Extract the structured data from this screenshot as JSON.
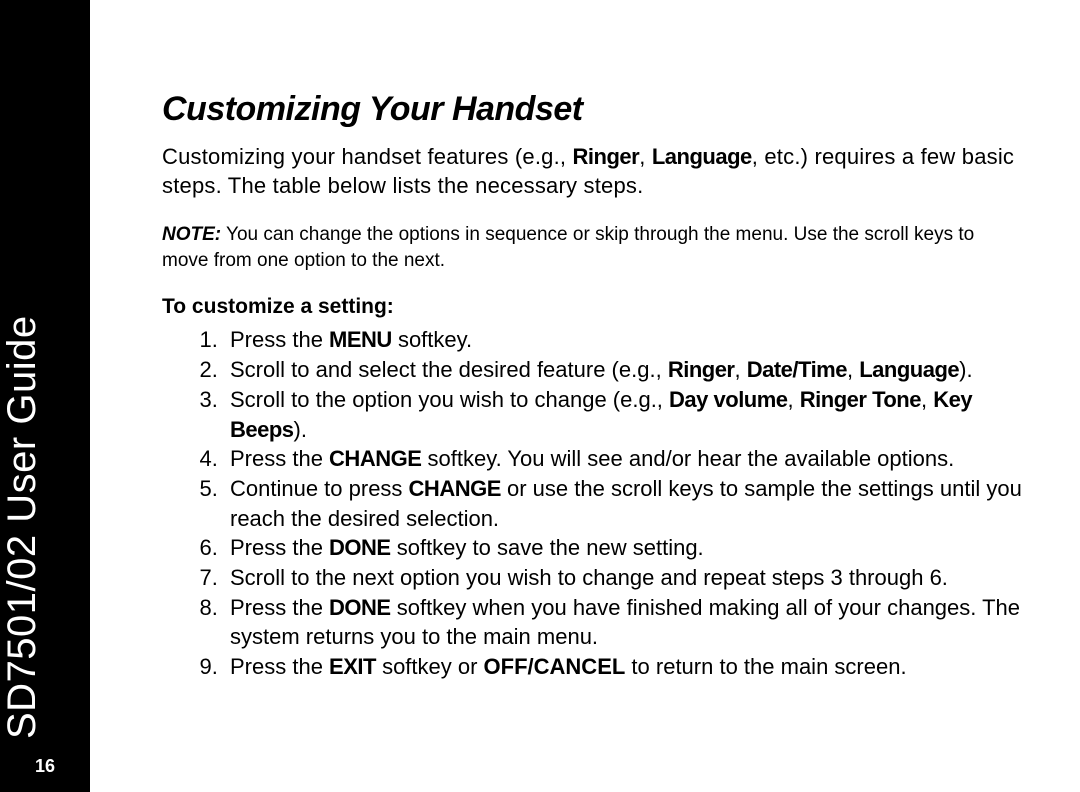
{
  "sidebar": {
    "guide_title": "SD7501/02 User Guide",
    "page_number": "16"
  },
  "content": {
    "heading": "Customizing Your Handset",
    "intro_pre": "Customizing your handset features (e.g., ",
    "intro_k1": "Ringer",
    "intro_mid1": ", ",
    "intro_k2": "Language",
    "intro_post": ", etc.) requires a few basic steps. The table below lists the necessary steps.",
    "note_label": "NOTE:",
    "note_body": "  You can change the options in sequence or skip through the menu. Use the scroll keys to move from one option to the next.",
    "subhead": "To customize a setting:",
    "steps": {
      "s1_pre": "Press the ",
      "s1_k": "MENU",
      "s1_post": " softkey.",
      "s2_pre": "Scroll to and select the desired feature (e.g., ",
      "s2_k1": "Ringer",
      "s2_c1": ", ",
      "s2_k2": "Date/Time",
      "s2_c2": ", ",
      "s2_k3": "Language",
      "s2_post": ").",
      "s3_pre": "Scroll to the option you wish to change (e.g., ",
      "s3_k1": "Day volume",
      "s3_c1": ", ",
      "s3_k2": "Ringer Tone",
      "s3_c2": ", ",
      "s3_k3": "Key Beeps",
      "s3_post": ").",
      "s4_pre": "Press the ",
      "s4_k": "CHANGE",
      "s4_post": " softkey. You will see and/or hear the available options.",
      "s5_pre": "Continue to press ",
      "s5_k": "CHANGE",
      "s5_post": " or use the scroll keys to sample the settings until you reach the desired selection.",
      "s6_pre": "Press the ",
      "s6_k": "DONE",
      "s6_post": " softkey to save the new setting.",
      "s7": "Scroll to the next option you wish to change and repeat steps 3 through 6.",
      "s8_pre": "Press the ",
      "s8_k": "DONE",
      "s8_post": " softkey when you have finished making all of your changes. The system returns you to the main menu.",
      "s9_pre": "Press the ",
      "s9_k1": "EXIT",
      "s9_mid": " softkey or ",
      "s9_k2": "OFF/CANCEL",
      "s9_post": " to return to the main screen."
    }
  }
}
